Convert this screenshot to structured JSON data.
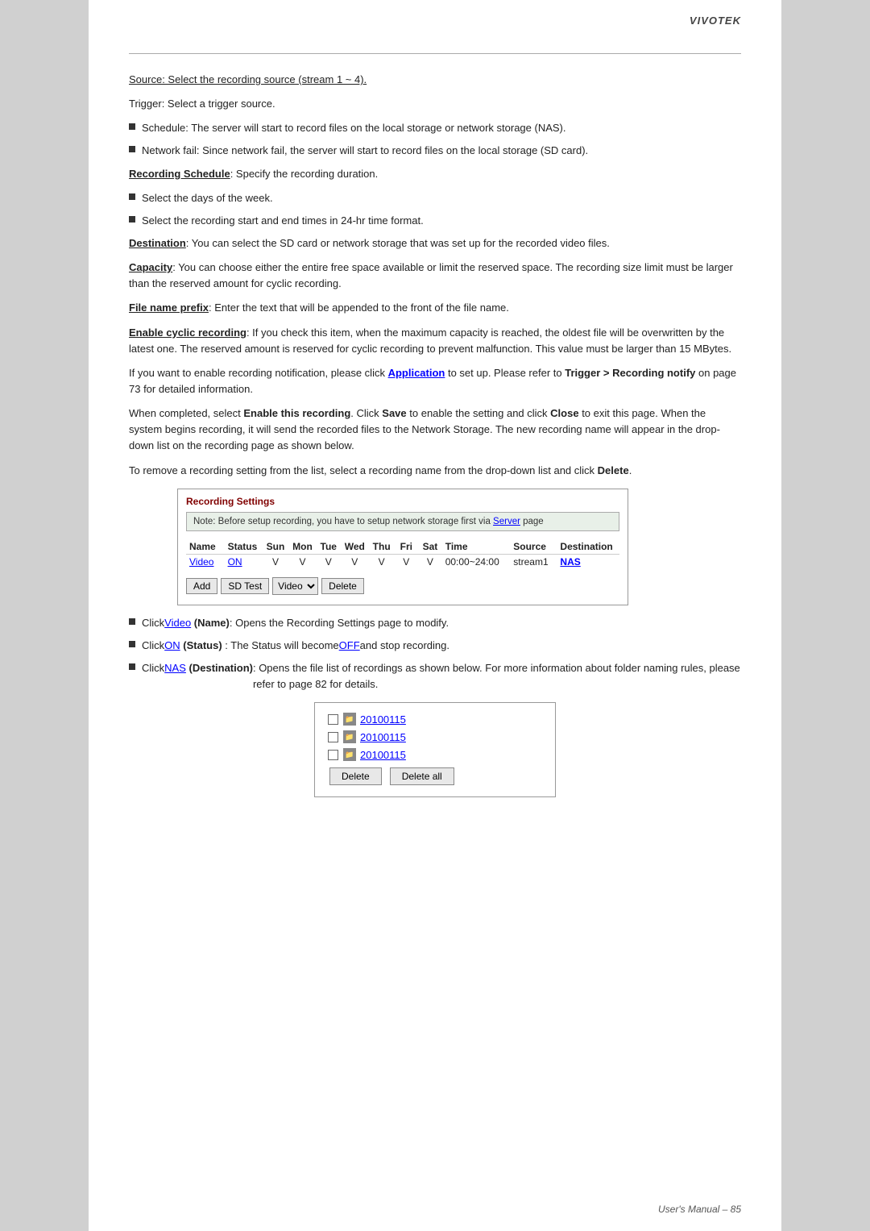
{
  "header": {
    "logo": "VIVOTEK",
    "footer": "User's Manual – 85"
  },
  "content": {
    "source_line": "Source: Select the recording source (stream 1 ~ 4).",
    "trigger_line": "Trigger: Select a trigger source.",
    "bullet1": "Schedule: The server will start to record files on the local storage or network storage (NAS).",
    "bullet2": "Network fail: Since network fail, the server will start to record files on the local storage (SD card).",
    "recording_schedule_label": "Recording Schedule",
    "recording_schedule_text": ": Specify the recording duration.",
    "bullet3": "Select the days of the week.",
    "bullet4": "Select the recording start and end times in 24-hr time format.",
    "destination_label": "Destination",
    "destination_text": ": You can select the SD card or network storage that was set up for the recorded video files.",
    "capacity_label": "Capacity",
    "capacity_text": ": You can choose either the entire free space available or limit the reserved space. The recording size limit must be larger than the reserved amount for cyclic recording.",
    "file_name_prefix_label": "File name prefix",
    "file_name_prefix_text": ": Enter the text that will be appended to the front of the file name.",
    "enable_cyclic_label": "Enable cyclic recording",
    "enable_cyclic_text": ": If you check this item, when the maximum capacity is reached, the oldest file will be overwritten by the latest one. The reserved amount is reserved for cyclic recording to prevent malfunction. This value must be larger than 15 MBytes.",
    "notification_text_before": "If you want to enable recording notification, please click ",
    "notification_link": "Application",
    "notification_text_after": " to set up. Please refer to ",
    "notification_bold": "Trigger > Recording notify",
    "notification_text_end": " on page 73 for detailed information.",
    "completed_text_before": "When completed, select ",
    "completed_bold1": "Enable this recording",
    "completed_text_mid1": ". Click ",
    "completed_bold2": "Save",
    "completed_text_mid2": " to enable the setting and click ",
    "completed_bold3": "Close",
    "completed_text_end": " to exit this page. When the system begins recording, it will send the recorded files to the Network Storage. The new recording name will appear in the drop-down list on the recording page as shown below.",
    "remove_text_before": "To remove a recording setting from the list, select a recording name from the drop-down list and click ",
    "remove_bold": "Delete",
    "remove_text_end": ".",
    "recording_settings": {
      "title": "Recording Settings",
      "note_text": "Note: Before setup recording, you have to setup network storage first via ",
      "note_link": "Server",
      "note_text_end": " page",
      "table": {
        "headers": [
          "Name",
          "Status",
          "Sun",
          "Mon",
          "Tue",
          "Wed",
          "Thu",
          "Fri",
          "Sat",
          "Time",
          "Source",
          "Destination"
        ],
        "row": {
          "name": "Video",
          "name_link": true,
          "status": "ON",
          "status_link": true,
          "sun": "V",
          "mon": "V",
          "tue": "V",
          "wed": "V",
          "thu": "V",
          "fri": "V",
          "sat": "V",
          "time": "00:00~24:00",
          "source": "stream1",
          "destination": "NAS",
          "destination_link": true
        }
      },
      "buttons": {
        "add": "Add",
        "sd_test": "SD Test",
        "video_dropdown": "Video",
        "delete": "Delete"
      }
    },
    "bullets_bottom": {
      "b1_pre": "Click ",
      "b1_link": "Video",
      "b1_mid": " (Name)",
      "b1_text": ": Opens the Recording Settings page to modify.",
      "b2_pre": "Click ",
      "b2_link": "ON",
      "b2_mid": " (Status)",
      "b2_text": ": The Status will become ",
      "b2_link2": "OFF",
      "b2_text2": " and stop recording.",
      "b3_pre": "Click ",
      "b3_link": "NAS",
      "b3_mid": " (Destination)",
      "b3_text": ": Opens the file list of recordings as shown below. For more information about folder naming rules, please refer to page 82 for details."
    },
    "file_list": {
      "items": [
        "20100115",
        "20100115",
        "20100115"
      ],
      "delete_btn": "Delete",
      "delete_all_btn": "Delete all"
    }
  }
}
